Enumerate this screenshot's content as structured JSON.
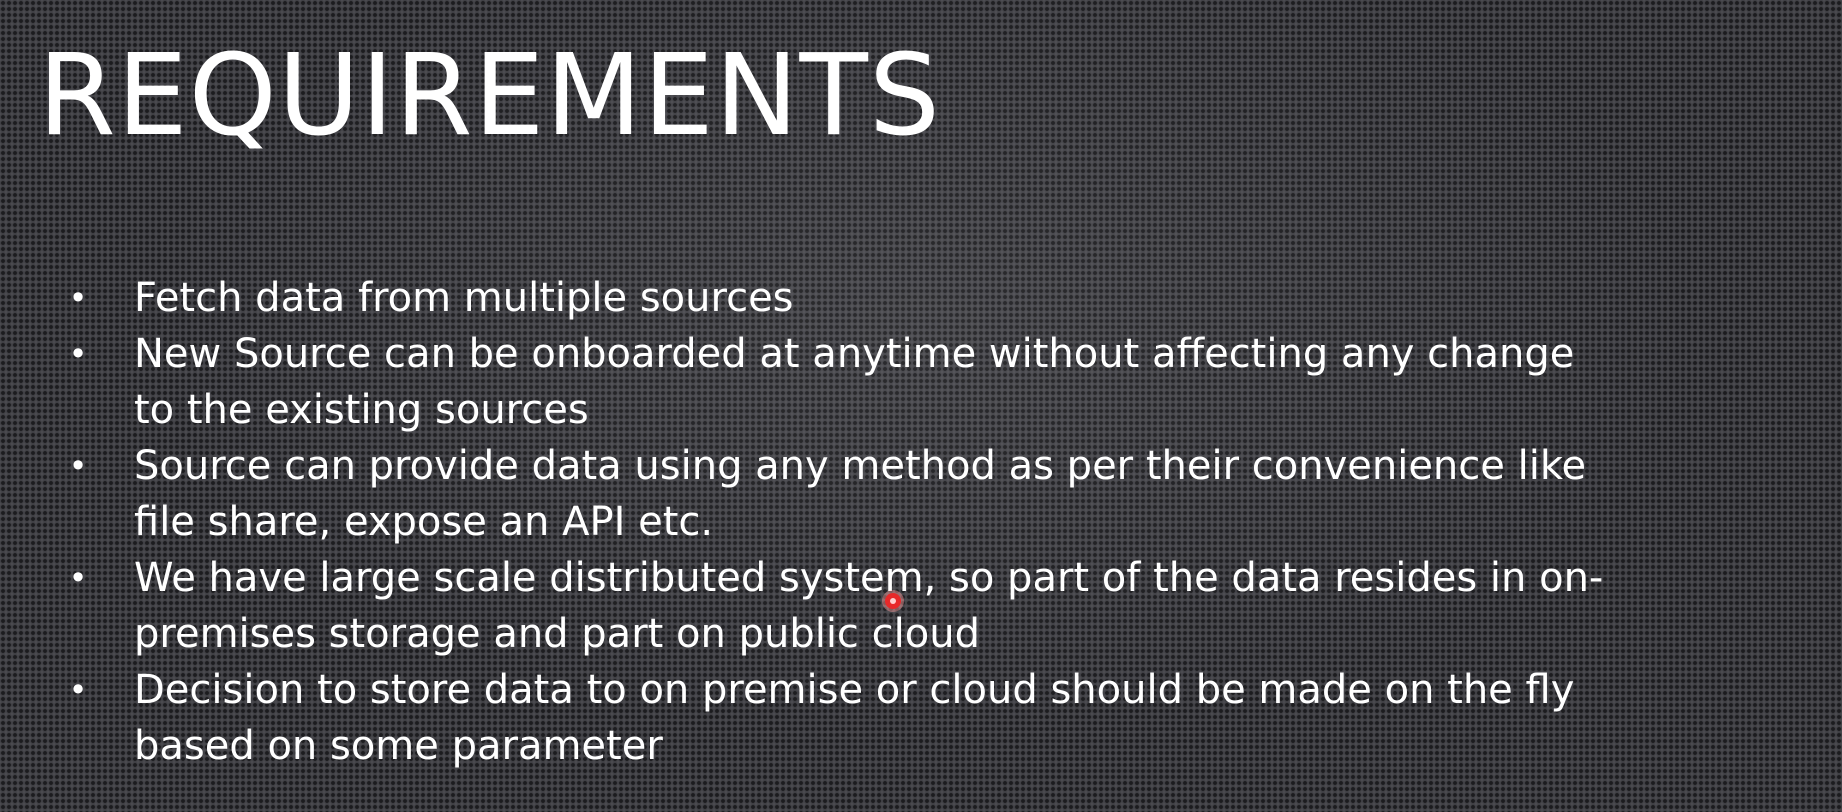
{
  "slide": {
    "title": "REQUIREMENTS",
    "bullet_symbol": "•",
    "bullets": [
      {
        "lines": [
          "Fetch data from multiple sources"
        ]
      },
      {
        "lines": [
          "New Source can be onboarded at anytime without affecting any change",
          "to the existing sources"
        ]
      },
      {
        "lines": [
          "Source can provide data using any method as per their convenience like",
          "file share, expose an API etc."
        ]
      },
      {
        "lines": [
          "We have large scale distributed system, so part of the data resides in on-",
          "premises storage and part on public cloud"
        ]
      },
      {
        "lines": [
          "Decision to store data to on premise or cloud should be made on the fly",
          "based on some parameter"
        ]
      }
    ]
  },
  "colors": {
    "background": "#3f3f44",
    "text": "#ffffff",
    "cursor": "#e8292a"
  }
}
